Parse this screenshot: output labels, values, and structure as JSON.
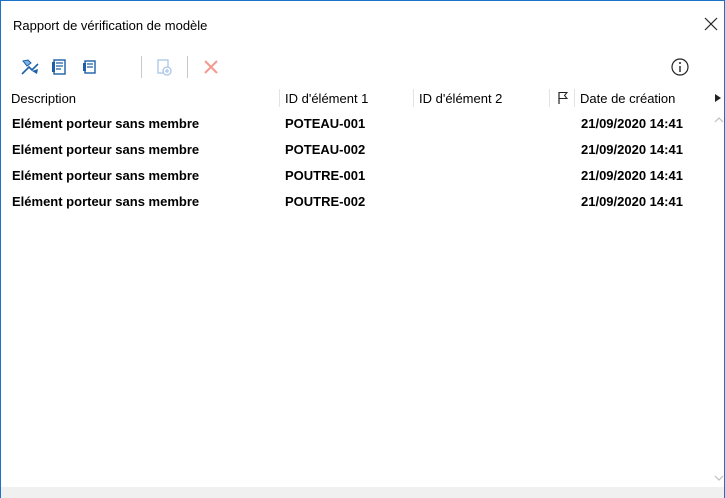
{
  "window": {
    "title": "Rapport de vérification de modèle",
    "close_icon": "close-icon",
    "accent_color": "#1a73c9"
  },
  "toolbar": {
    "buttons": [
      {
        "name": "zoom-to-element-button",
        "icon": "zoom-element-icon",
        "enabled": true
      },
      {
        "name": "report-view-button",
        "icon": "report-icon",
        "enabled": true
      },
      {
        "name": "report-alt-button",
        "icon": "report-alt-icon",
        "enabled": true
      },
      {
        "name": "add-item-button",
        "icon": "add-item-icon",
        "enabled": false
      },
      {
        "name": "delete-button",
        "icon": "delete-x-icon",
        "enabled": false
      }
    ],
    "info_icon": "info-icon"
  },
  "table": {
    "columns": [
      "Description",
      "ID d'élément 1",
      "ID d'élément 2",
      "",
      "Date de création"
    ],
    "flag_icon": "flag-icon",
    "rows": [
      {
        "description": "Elément porteur sans membre",
        "id1": "POTEAU-001",
        "id2": "",
        "date": "21/09/2020 14:41"
      },
      {
        "description": "Elément porteur sans membre",
        "id1": "POTEAU-002",
        "id2": "",
        "date": "21/09/2020 14:41"
      },
      {
        "description": "Elément porteur sans membre",
        "id1": "POUTRE-001",
        "id2": "",
        "date": "21/09/2020 14:41"
      },
      {
        "description": "Elément porteur sans membre",
        "id1": "POUTRE-002",
        "id2": "",
        "date": "21/09/2020 14:41"
      }
    ]
  }
}
